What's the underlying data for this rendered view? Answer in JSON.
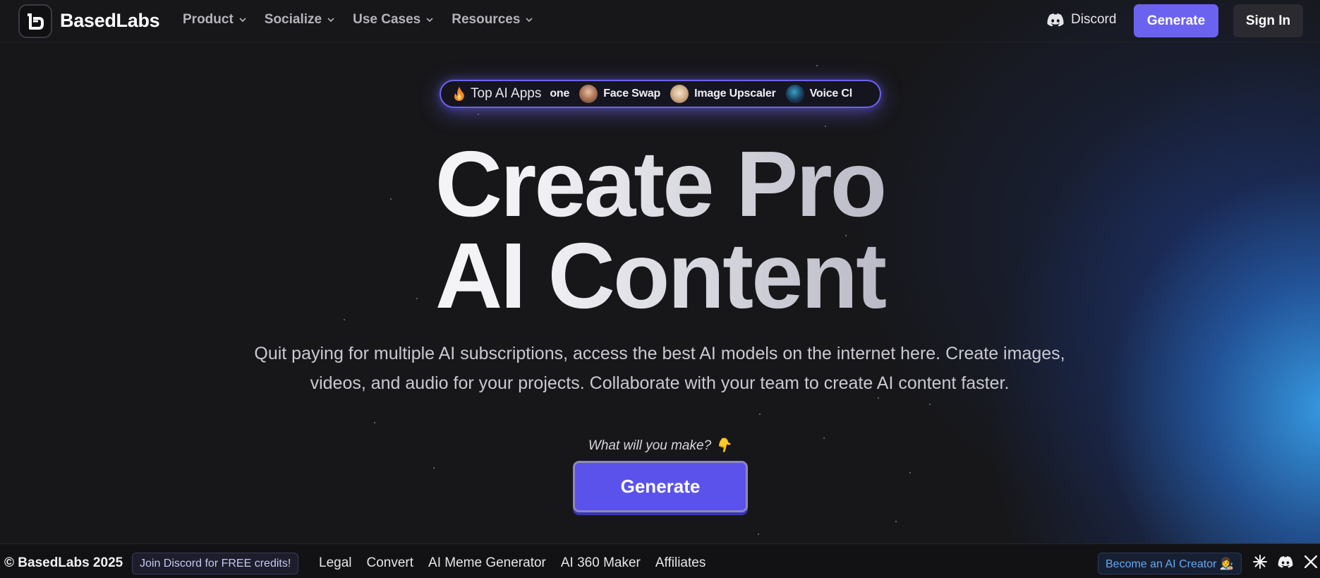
{
  "nav": {
    "brand": "BasedLabs",
    "menu": [
      {
        "label": "Product"
      },
      {
        "label": "Socialize"
      },
      {
        "label": "Use Cases"
      },
      {
        "label": "Resources"
      }
    ],
    "discord_label": "Discord",
    "generate_label": "Generate",
    "signin_label": "Sign In"
  },
  "pill": {
    "label": "Top AI Apps",
    "apps": [
      {
        "label": "one"
      },
      {
        "label": "Face Swap"
      },
      {
        "label": "Image Upscaler"
      },
      {
        "label": "Voice Cl"
      }
    ]
  },
  "hero": {
    "line1": "Create Pro",
    "line2": "AI Content",
    "subtitle": "Quit paying for multiple AI subscriptions, access the best AI models on the internet here. Create images, videos, and audio for your projects. Collaborate with your team to create AI content faster.",
    "prompt": "What will you make? 👇",
    "cta_label": "Generate"
  },
  "footer": {
    "copyright": "© BasedLabs 2025",
    "join_label": "Join Discord for FREE credits!",
    "links": [
      {
        "label": "Legal"
      },
      {
        "label": "Convert"
      },
      {
        "label": "AI Meme Generator"
      },
      {
        "label": "AI 360 Maker"
      },
      {
        "label": "Affiliates"
      }
    ],
    "creator_label": "Become an AI Creator 👩‍🎨"
  },
  "colors": {
    "accent": "#6b63f0",
    "background": "#17171a",
    "glow": "#38a0eb",
    "creator_text": "#64a8f2"
  },
  "icons": {
    "pill_icon": "fire-icon",
    "discord": "discord-icon",
    "footer_icons": [
      "sparkle-icon",
      "discord-icon",
      "x-icon"
    ]
  }
}
